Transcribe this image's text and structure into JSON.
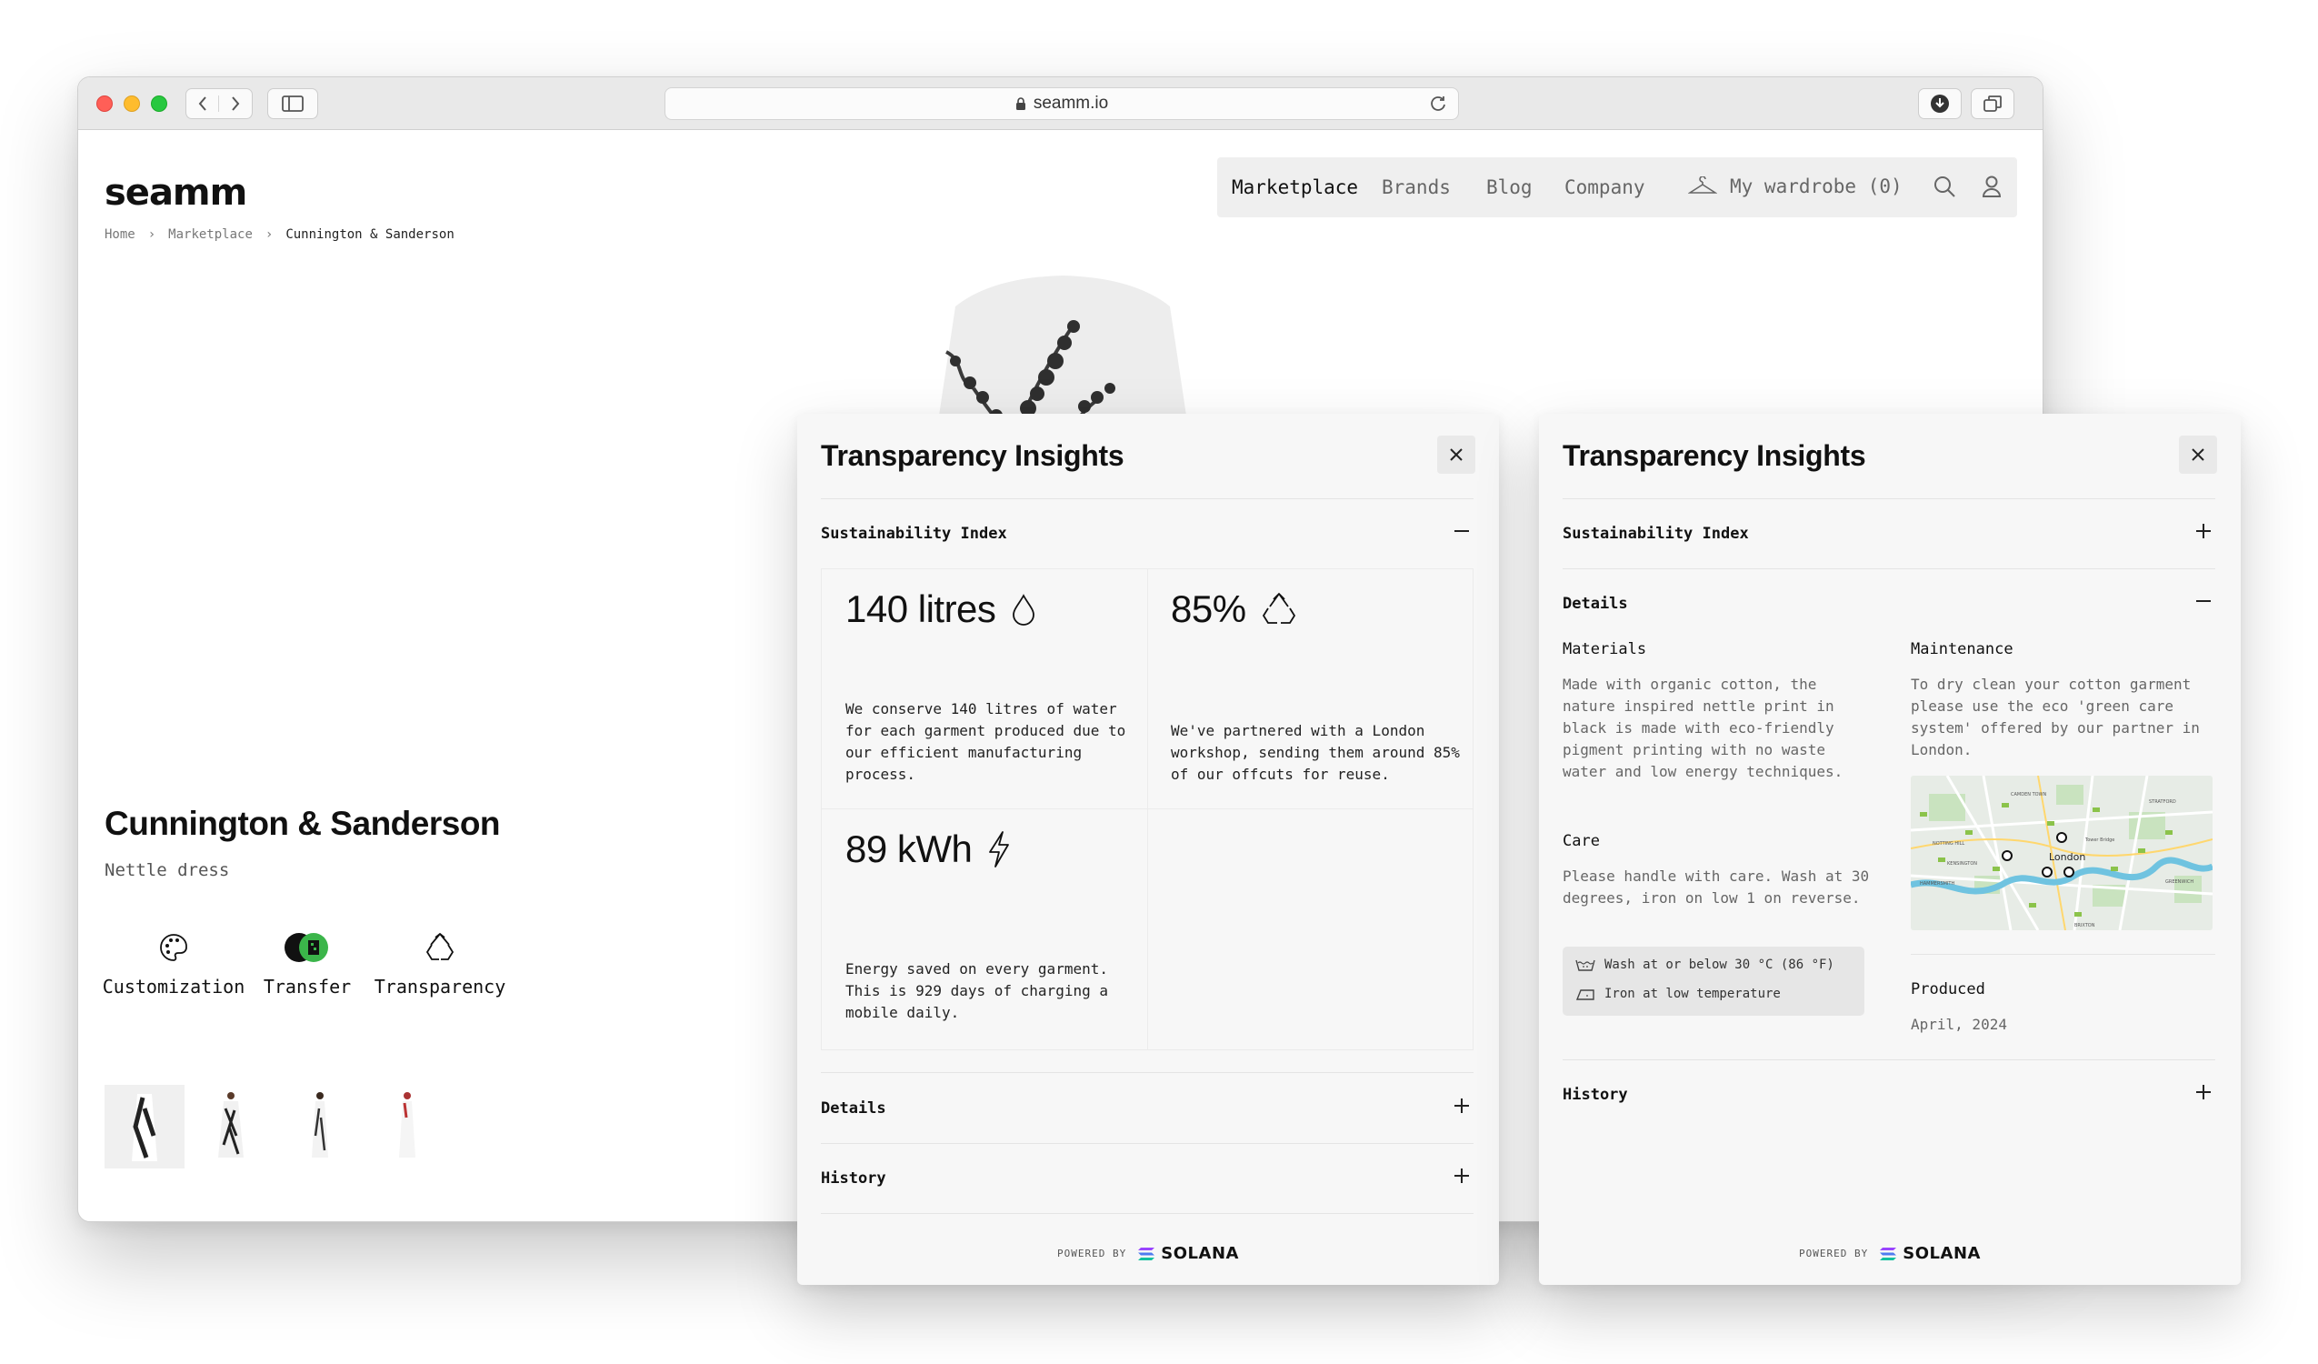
{
  "browser": {
    "url": "seamm.io"
  },
  "site": {
    "logo": "seamm",
    "nav": {
      "marketplace": "Marketplace",
      "brands": "Brands",
      "blog": "Blog",
      "company": "Company",
      "wardrobe": "My wardrobe (0)"
    },
    "breadcrumb": [
      "Home",
      "Marketplace",
      "Cunnington & Sanderson"
    ]
  },
  "product": {
    "brand": "Cunnington & Sanderson",
    "name": "Nettle dress",
    "features": [
      "Customization",
      "Transfer",
      "Transparency"
    ],
    "thumbnails_count": 4
  },
  "panel_left": {
    "title": "Transparency Insights",
    "sustainability_label": "Sustainability Index",
    "metrics": [
      {
        "value": "140 litres",
        "icon": "water-drop-icon",
        "text": "We conserve 140 litres of water for each garment produced due to our efficient manufacturing process."
      },
      {
        "value": "85%",
        "icon": "recycle-icon",
        "text": "We've partnered with a London workshop, sending them around 85% of our offcuts for reuse."
      },
      {
        "value": "89 kWh",
        "icon": "lightning-icon",
        "text": "Energy saved on every garment. This is 929 days of charging a mobile daily."
      }
    ],
    "details_label": "Details",
    "history_label": "History",
    "powered_by": "POWERED BY",
    "solana": "SOLANA"
  },
  "panel_right": {
    "title": "Transparency Insights",
    "sustainability_label": "Sustainability Index",
    "details_label": "Details",
    "materials_label": "Materials",
    "materials_text": "Made with organic cotton, the nature inspired nettle print in black is made with eco-friendly pigment printing with no waste water and low energy techniques.",
    "maintenance_label": "Maintenance",
    "maintenance_text": "To dry clean your cotton garment please use the eco 'green care system' offered by our partner in London.",
    "care_label": "Care",
    "care_text": "Please handle with care. Wash at 30 degrees, iron on low 1 on reverse.",
    "care_wash": "Wash at or below 30 °C (86 °F)",
    "care_iron": "Iron at low temperature",
    "map_label": "London",
    "map_areas": [
      "CAMDEN TOWN",
      "STRATFORD",
      "NOTTING HILL",
      "KENSINGTON",
      "HAMMERSMITH",
      "GREENWICH",
      "BRIXTON",
      "Tower Bridge"
    ],
    "produced_label": "Produced",
    "produced_value": "April, 2024",
    "history_label": "History",
    "powered_by": "POWERED BY",
    "solana": "SOLANA"
  }
}
